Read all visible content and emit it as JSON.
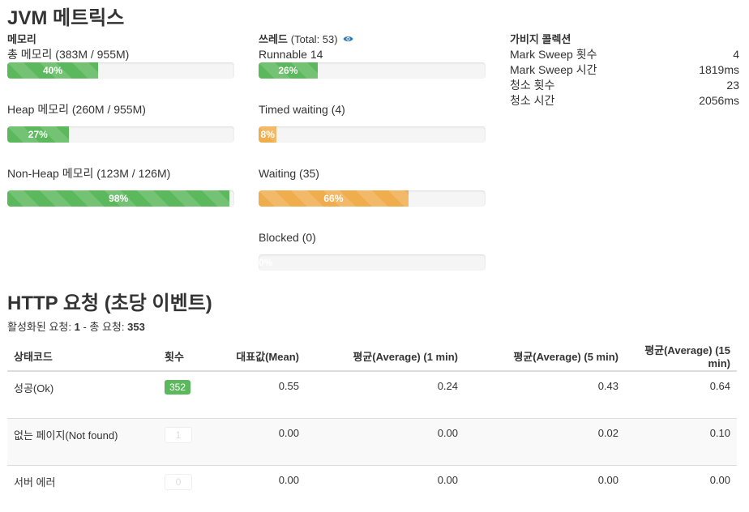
{
  "jvm": {
    "title": "JVM 메트릭스",
    "memory": {
      "heading": "메모리",
      "items": [
        {
          "label": "총 메모리 (383M / 955M)",
          "percent": 40,
          "text": "40%",
          "color": "green"
        },
        {
          "label": "Heap 메모리 (260M / 955M)",
          "percent": 27,
          "text": "27%",
          "color": "green"
        },
        {
          "label": "Non-Heap 메모리 (123M / 126M)",
          "percent": 98,
          "text": "98%",
          "color": "green"
        }
      ]
    },
    "threads": {
      "heading": "쓰레드",
      "total": "(Total: 53)",
      "items": [
        {
          "label": "Runnable 14",
          "percent": 26,
          "text": "26%",
          "color": "green"
        },
        {
          "label": "Timed waiting (4)",
          "percent": 8,
          "text": "8%",
          "color": "orange"
        },
        {
          "label": "Waiting (35)",
          "percent": 66,
          "text": "66%",
          "color": "orange"
        },
        {
          "label": "Blocked (0)",
          "percent": 0,
          "text": "0%",
          "color": "empty"
        }
      ]
    },
    "gc": {
      "heading": "가비지 콜렉션",
      "rows": [
        {
          "name": "Mark Sweep 횟수",
          "value": "4"
        },
        {
          "name": "Mark Sweep 시간",
          "value": "1819ms"
        },
        {
          "name": "청소 횟수",
          "value": "23"
        },
        {
          "name": "청소 시간",
          "value": "2056ms"
        }
      ]
    }
  },
  "http": {
    "title": "HTTP 요청 (초당 이벤트)",
    "summary_prefix": "활성화된 요청: ",
    "active": "1",
    "summary_mid": " - 총 요청: ",
    "total": "353",
    "headers": [
      "상태코드",
      "횟수",
      "대표값(Mean)",
      "평균(Average) (1 min)",
      "평균(Average) (5 min)",
      "평균(Average) (15 min)"
    ],
    "rows": [
      {
        "status": "성공(Ok)",
        "count": "352",
        "count_style": "ok",
        "mean": "0.55",
        "m1": "0.24",
        "m5": "0.43",
        "m15": "0.64"
      },
      {
        "status": "없는 페이지(Not found)",
        "count": "1",
        "count_style": "zero",
        "mean": "0.00",
        "m1": "0.00",
        "m5": "0.02",
        "m15": "0.10"
      },
      {
        "status": "서버 에러",
        "count": "0",
        "count_style": "zero",
        "mean": "0.00",
        "m1": "0.00",
        "m5": "0.00",
        "m15": "0.00"
      }
    ]
  },
  "colors": {
    "green": "#5cb85c",
    "orange": "#f0ad4e",
    "link": "#337ab7"
  },
  "icons": {
    "threads_view": "eye-icon"
  }
}
